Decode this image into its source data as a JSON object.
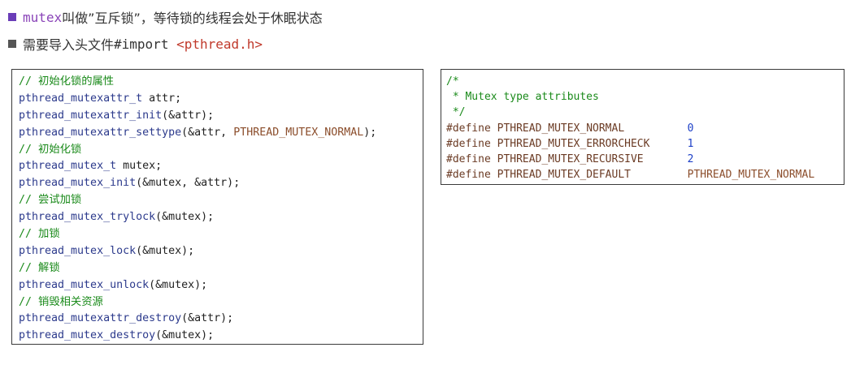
{
  "bullets": [
    {
      "icon": "square-bullet-icon",
      "color": "#6a3db8",
      "keyword": "mutex",
      "text": "叫做”互斥锁”，等待锁的线程会处于休眠状态"
    },
    {
      "icon": "square-bullet-icon",
      "color": "#555555",
      "text": "需要导入头文件",
      "code": "#import ",
      "header": "<pthread.h>"
    }
  ],
  "left_code": {
    "c0": "// 初始化锁的属性",
    "l1_type": "pthread_mutexattr_t",
    "l1_rest": " attr;",
    "l2_fn": "pthread_mutexattr_init",
    "l2_rest": "(&attr);",
    "l3_fn": "pthread_mutexattr_settype",
    "l3_mid": "(&attr, ",
    "l3_macro": "PTHREAD_MUTEX_NORMAL",
    "l3_end": ");",
    "c1": "// 初始化锁",
    "l4_type": "pthread_mutex_t",
    "l4_rest": " mutex;",
    "l5_fn": "pthread_mutex_init",
    "l5_rest": "(&mutex, &attr);",
    "c2": "// 尝试加锁",
    "l6_fn": "pthread_mutex_trylock",
    "l6_rest": "(&mutex);",
    "c3": "// 加锁",
    "l7_fn": "pthread_mutex_lock",
    "l7_rest": "(&mutex);",
    "c4": "// 解锁",
    "l8_fn": "pthread_mutex_unlock",
    "l8_rest": "(&mutex);",
    "c5": "// 销毁相关资源",
    "l9_fn": "pthread_mutexattr_destroy",
    "l9_rest": "(&attr);",
    "l10_fn": "pthread_mutex_destroy",
    "l10_rest": "(&mutex);"
  },
  "right_code": {
    "comment_open": "/*",
    "comment_body": " * Mutex type attributes",
    "comment_close": " */",
    "defines": [
      {
        "directive": "#define",
        "name": "PTHREAD_MUTEX_NORMAL",
        "value": "0"
      },
      {
        "directive": "#define",
        "name": "PTHREAD_MUTEX_ERRORCHECK",
        "value": "1"
      },
      {
        "directive": "#define",
        "name": "PTHREAD_MUTEX_RECURSIVE",
        "value": "2"
      },
      {
        "directive": "#define",
        "name": "PTHREAD_MUTEX_DEFAULT",
        "value": "PTHREAD_MUTEX_NORMAL"
      }
    ]
  }
}
